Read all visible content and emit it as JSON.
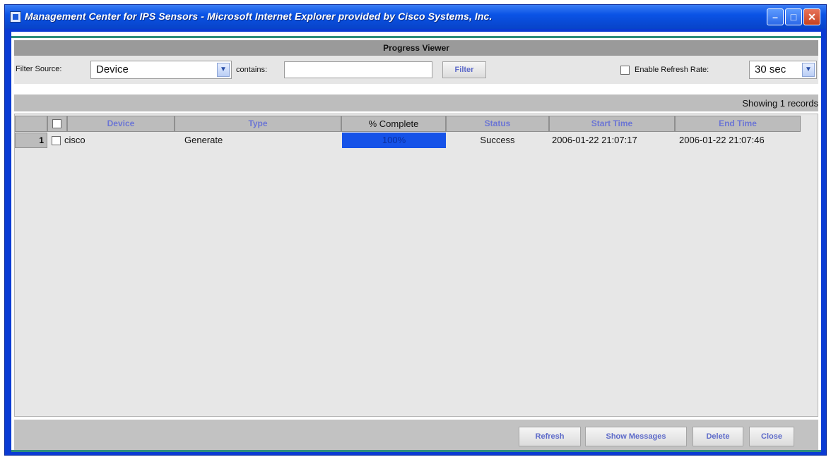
{
  "window": {
    "title": "Management Center for IPS Sensors - Microsoft Internet Explorer provided by Cisco Systems, Inc.",
    "controls": {
      "minimize": "–",
      "maximize": "□",
      "close": "✕"
    }
  },
  "panel": {
    "title": "Progress Viewer"
  },
  "filter": {
    "source_label": "Filter Source:",
    "source_value": "Device",
    "contains_label": "contains:",
    "contains_value": "",
    "filter_button": "Filter",
    "refresh_label": "Enable Refresh Rate:",
    "refresh_enabled": false,
    "refresh_value": "30 sec"
  },
  "records_text": "Showing 1 records",
  "table": {
    "columns": [
      "Device",
      "Type",
      "% Complete",
      "Status",
      "Start Time",
      "End Time"
    ],
    "rows": [
      {
        "index": "1",
        "device": "cisco",
        "type": "Generate",
        "complete_label": "100%",
        "complete_fraction": 1.0,
        "status": "Success",
        "start_time": "2006-01-22 21:07:17",
        "end_time": "2006-01-22 21:07:46"
      }
    ]
  },
  "buttons": {
    "refresh": "Refresh",
    "show_messages": "Show Messages",
    "delete": "Delete",
    "close": "Close"
  },
  "icons": {
    "dropdown": "chevron-down-icon",
    "app": "ie-app-icon"
  },
  "colors": {
    "titlebar": "#0a53e6",
    "progress": "#1552e8",
    "accent_text": "#6b75d4",
    "rule": "#2f8e7c"
  }
}
